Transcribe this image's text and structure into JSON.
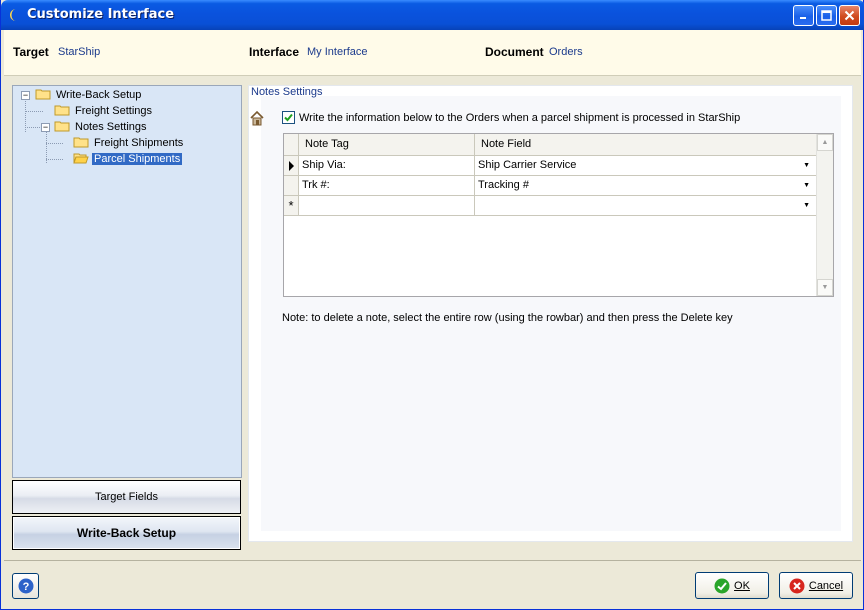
{
  "window": {
    "title": "Customize Interface"
  },
  "header": {
    "target_label": "Target",
    "target_value": "StarShip",
    "interface_label": "Interface",
    "interface_value": "My Interface",
    "document_label": "Document",
    "document_value": "Orders"
  },
  "tree": {
    "root": "Write-Back Setup",
    "freight": "Freight Settings",
    "notes": "Notes Settings",
    "notes_freight": "Freight Shipments",
    "notes_parcel": "Parcel Shipments"
  },
  "nav": {
    "target_fields": "Target Fields",
    "write_back": "Write-Back Setup"
  },
  "section": {
    "title": "Notes Settings",
    "checkbox_label": "Write the information below to the Orders when a parcel shipment is processed in StarShip",
    "checkbox_checked": true
  },
  "grid": {
    "headers": [
      "Note Tag",
      "Note Field"
    ],
    "rows": [
      {
        "tag": "Ship Via:",
        "field": "Ship Carrier Service"
      },
      {
        "tag": "Trk #:",
        "field": "Tracking #"
      },
      {
        "tag": "",
        "field": ""
      }
    ]
  },
  "note": "Note: to delete a note, select the entire row (using the rowbar) and then press the Delete key",
  "footer": {
    "ok": "OK",
    "cancel": "Cancel",
    "help": "?"
  },
  "colors": {
    "titlebar": "#0a52dd",
    "header_band": "#fffbe9",
    "tree_panel": "#d9e6f6",
    "link_text": "#1b3a8c",
    "selection": "#316ac5"
  }
}
